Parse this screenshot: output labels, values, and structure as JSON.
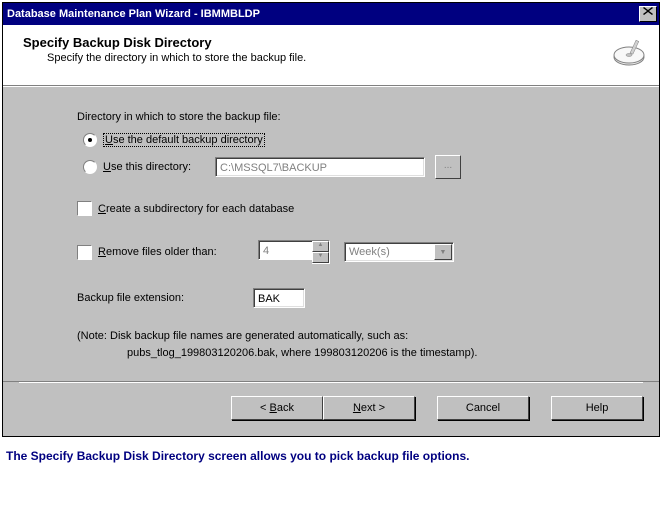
{
  "titlebar": {
    "title": "Database Maintenance Plan Wizard - IBMMBLDP",
    "close_label": "×"
  },
  "header": {
    "title": "Specify Backup Disk Directory",
    "subtitle": "Specify the directory in which to store the backup file."
  },
  "content": {
    "intro": "Directory in which to store the backup file:",
    "radio_default": "se the default backup directory",
    "radio_default_ul": "U",
    "radio_usethis": "se this directory:",
    "radio_usethis_ul": "U",
    "path_value": "C:\\MSSQL7\\BACKUP",
    "browse_label": "...",
    "check_subdir": "reate a subdirectory for each database",
    "check_subdir_ul": "C",
    "check_remove": "emove files older than:",
    "check_remove_ul": "R",
    "remove_value": "4",
    "remove_unit": "Week(s)",
    "ext_label": "Backup file extension:",
    "ext_value": "BAK",
    "note_line1": "(Note: Disk backup file names are generated automatically, such as:",
    "note_line2": "pubs_tlog_199803120206.bak, where 199803120206 is the timestamp)."
  },
  "buttons": {
    "back_prefix": "< ",
    "back": "ack",
    "back_ul": "B",
    "next": "ext",
    "next_ul": "N",
    "next_suffix": " >",
    "cancel": "Cancel",
    "help": "Help"
  },
  "caption": "The Specify Backup Disk Directory screen  allows you to pick backup file options."
}
